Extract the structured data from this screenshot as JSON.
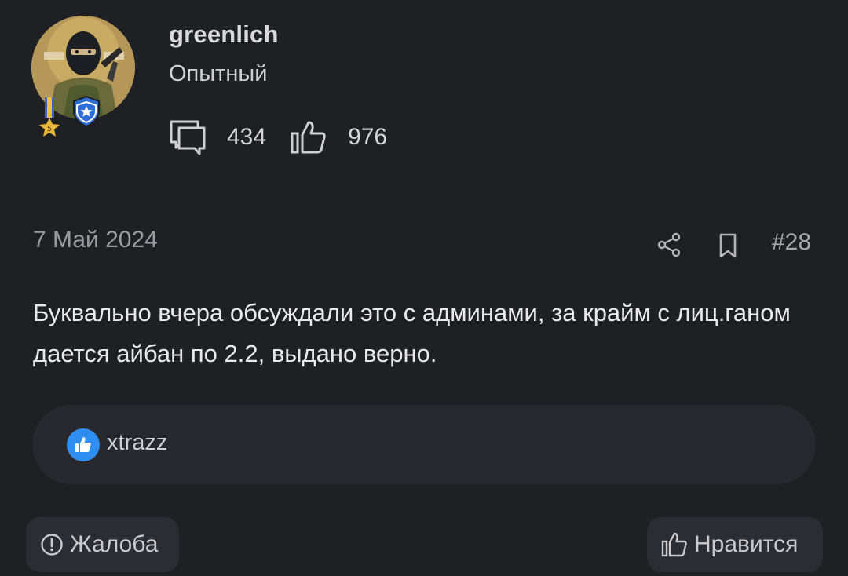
{
  "author": {
    "username": "greenlich",
    "title": "Опытный",
    "medal_level": "5",
    "stats": {
      "messages_icon": "speech-bubble-icon",
      "messages": "434",
      "likes_icon": "thumbs-up-icon",
      "likes": "976"
    }
  },
  "post": {
    "date": "7 Май 2024",
    "number": "#28",
    "text": "Буквально вчера обсуждали это с админами, за крайм с лиц.ганом дается айбан по 2.2, выдано верно."
  },
  "reactions": {
    "reactor": "xtrazz"
  },
  "actions": {
    "report_label": "Жалоба",
    "like_label": "Нравится"
  },
  "colors": {
    "background": "#1f2024",
    "reaction_bar": "#28292e",
    "like_blue": "#2f8ff0",
    "guard_blue": "#2d6fd6"
  }
}
